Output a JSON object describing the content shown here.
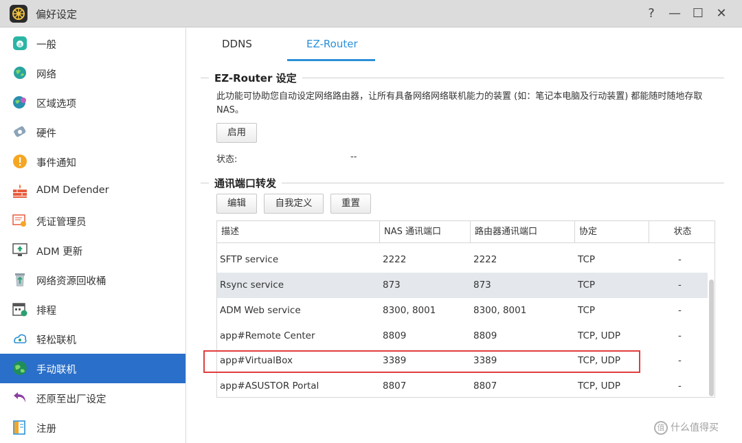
{
  "window": {
    "title": "偏好设定",
    "help": "?",
    "minimize": "—",
    "maximize": "☐",
    "close": "✕"
  },
  "sidebar": {
    "items": [
      {
        "label": "一般",
        "icon": "general-icon"
      },
      {
        "label": "网络",
        "icon": "globe-icon"
      },
      {
        "label": "区域选项",
        "icon": "region-icon"
      },
      {
        "label": "硬件",
        "icon": "hardware-icon"
      },
      {
        "label": "事件通知",
        "icon": "alert-icon"
      },
      {
        "label": "ADM Defender",
        "icon": "firewall-icon"
      },
      {
        "label": "凭证管理员",
        "icon": "certificate-icon"
      },
      {
        "label": "ADM 更新",
        "icon": "update-icon"
      },
      {
        "label": "网络资源回收桶",
        "icon": "recycle-icon"
      },
      {
        "label": "排程",
        "icon": "calendar-icon"
      },
      {
        "label": "轻松联机",
        "icon": "connect-icon"
      },
      {
        "label": "手动联机",
        "icon": "manual-connect-icon"
      },
      {
        "label": "还原至出厂设定",
        "icon": "restore-icon"
      },
      {
        "label": "注册",
        "icon": "register-icon"
      }
    ],
    "active_index": 11
  },
  "tabs": {
    "ddns": "DDNS",
    "ez_router": "EZ-Router"
  },
  "ez_router": {
    "title": "EZ-Router 设定",
    "description": "此功能可协助您自动设定网络路由器，让所有具备网络网络联机能力的装置 (如：笔记本电脑及行动装置) 都能随时随地存取 NAS。",
    "enable_button": "启用",
    "status_label": "状态:",
    "status_value": "--"
  },
  "port_forwarding": {
    "title": "通讯端口转发",
    "edit_button": "编辑",
    "custom_button": "自我定义",
    "reset_button": "重置",
    "columns": [
      "描述",
      "NAS 通讯端口",
      "路由器通讯端口",
      "协定",
      "状态"
    ],
    "rows": [
      {
        "desc": "SFTP service",
        "nas": "2222",
        "router": "2222",
        "proto": "TCP",
        "status": "-"
      },
      {
        "desc": "Rsync service",
        "nas": "873",
        "router": "873",
        "proto": "TCP",
        "status": "-"
      },
      {
        "desc": "ADM Web service",
        "nas": "8300, 8001",
        "router": "8300, 8001",
        "proto": "TCP",
        "status": "-"
      },
      {
        "desc": "app#Remote Center",
        "nas": "8809",
        "router": "8809",
        "proto": "TCP, UDP",
        "status": "-"
      },
      {
        "desc": "app#VirtualBox",
        "nas": "3389",
        "router": "3389",
        "proto": "TCP, UDP",
        "status": "-"
      },
      {
        "desc": "app#ASUSTOR Portal",
        "nas": "8807",
        "router": "8807",
        "proto": "TCP, UDP",
        "status": "-"
      }
    ]
  },
  "watermark": {
    "icon_text": "值",
    "text": "什么值得买"
  },
  "colors": {
    "accent": "#2a8fd8",
    "sidebar_active": "#2a6fc9",
    "highlight": "#e03c3c"
  }
}
